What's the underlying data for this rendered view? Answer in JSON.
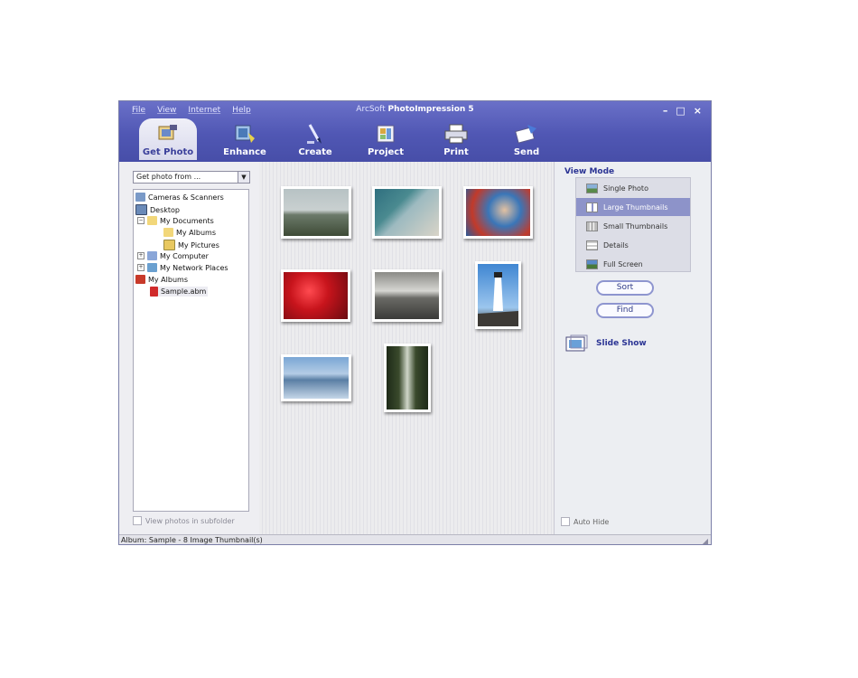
{
  "window": {
    "title_prefix": "ArcSoft",
    "title_main": "PhotoImpression 5",
    "controls": {
      "minimize": "–",
      "maximize": "□",
      "close": "×"
    }
  },
  "menu": [
    "File",
    "View",
    "Internet",
    "Help"
  ],
  "toolbar": [
    {
      "label": "Get Photo",
      "icon": "camera-photo-icon",
      "active": true
    },
    {
      "label": "Enhance",
      "icon": "enhance-icon"
    },
    {
      "label": "Create",
      "icon": "create-pen-icon"
    },
    {
      "label": "Project",
      "icon": "project-icon"
    },
    {
      "label": "Print",
      "icon": "printer-icon"
    },
    {
      "label": "Send",
      "icon": "send-icon"
    }
  ],
  "left_panel": {
    "source_select": "Get photo from ...",
    "tree": [
      {
        "label": "Cameras & Scanners",
        "icon": "camera-icon",
        "depth": 0
      },
      {
        "label": "Desktop",
        "icon": "desktop-icon",
        "depth": 0
      },
      {
        "label": "My Documents",
        "icon": "folder-icon",
        "depth": 1,
        "expander": "−"
      },
      {
        "label": "My Albums",
        "icon": "folder-icon",
        "depth": 2
      },
      {
        "label": "My Pictures",
        "icon": "folder-pictures-icon",
        "depth": 2
      },
      {
        "label": "My Computer",
        "icon": "computer-icon",
        "depth": 1,
        "expander": "+"
      },
      {
        "label": "My Network Places",
        "icon": "network-icon",
        "depth": 1,
        "expander": "+"
      },
      {
        "label": "My Albums",
        "icon": "album-icon",
        "depth": 0
      },
      {
        "label": "Sample.abm",
        "icon": "album-file-icon",
        "depth": 1,
        "selected": true
      }
    ],
    "subfolder_checkbox": "View photos in subfolder"
  },
  "thumbnails": [
    {
      "name": "field-landscape",
      "colors": [
        "#b7c2c4",
        "#6c7a6a",
        "#3e4b36"
      ]
    },
    {
      "name": "beach-shore",
      "colors": [
        "#2f6f7f",
        "#9dbac0",
        "#d9d4c8"
      ]
    },
    {
      "name": "child-portrait",
      "colors": [
        "#3a76b8",
        "#e2c1a2",
        "#c23a2a"
      ]
    },
    {
      "name": "red-flowers",
      "colors": [
        "#c8141c",
        "#e2262e",
        "#6a0a10"
      ]
    },
    {
      "name": "sunset-sea",
      "colors": [
        "#d6d6d2",
        "#8a8a86",
        "#3a3a38"
      ]
    },
    {
      "name": "lighthouse",
      "colors": [
        "#3f86d2",
        "#9cc6ee",
        "#3d3a36"
      ]
    },
    {
      "name": "mountain-lake",
      "colors": [
        "#7aa6d4",
        "#5a7ea4",
        "#c4d6e8"
      ]
    },
    {
      "name": "forest-waterfall",
      "colors": [
        "#3a4a2c",
        "#cfd6c8",
        "#1e2a18"
      ]
    }
  ],
  "right_panel": {
    "view_mode_title": "View Mode",
    "view_modes": [
      {
        "label": "Single Photo",
        "icon": "single-photo-icon"
      },
      {
        "label": "Large Thumbnails",
        "icon": "large-thumbnails-icon",
        "selected": true
      },
      {
        "label": "Small Thumbnails",
        "icon": "small-thumbnails-icon"
      },
      {
        "label": "Details",
        "icon": "details-icon"
      },
      {
        "label": "Full Screen",
        "icon": "full-screen-icon"
      }
    ],
    "sort_label": "Sort",
    "find_label": "Find",
    "slideshow_label": "Slide Show",
    "autohide_label": "Auto Hide"
  },
  "status_bar": "Album: Sample - 8 Image Thumbnail(s)",
  "colors": {
    "header": "#5057b4",
    "accent": "#2b3494",
    "selected": "#8d93c9"
  }
}
